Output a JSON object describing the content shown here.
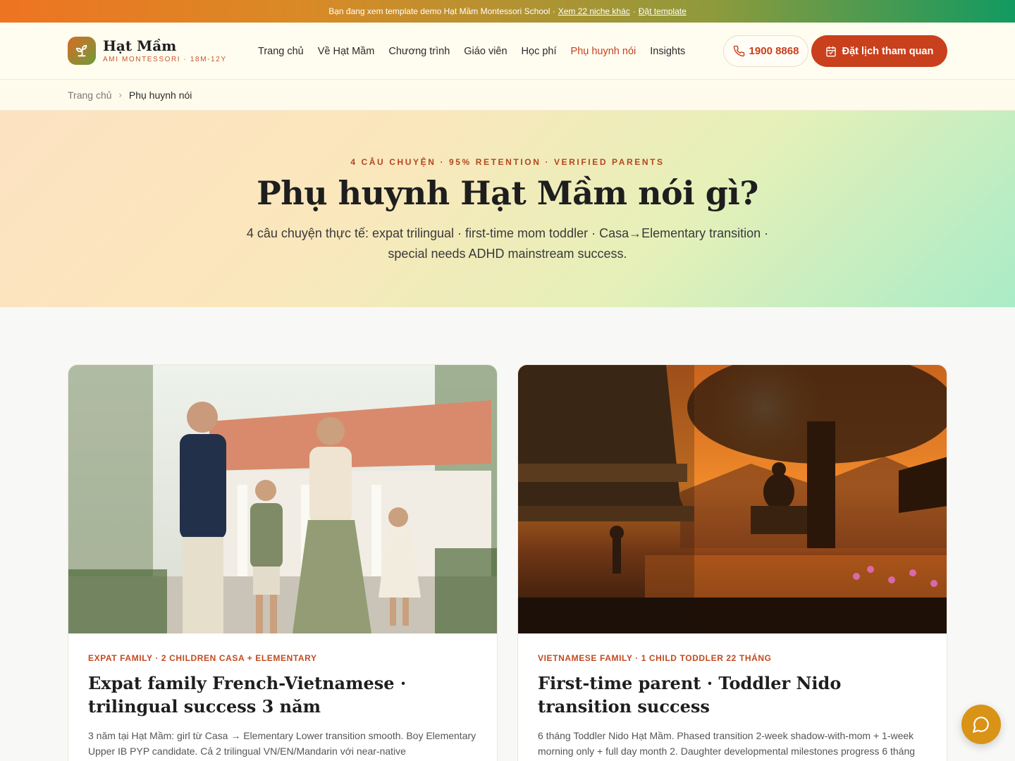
{
  "topbar": {
    "text": "Bạn đang xem template demo Hạt Mầm Montessori School ·",
    "link_more": "Xem 22 niche khác",
    "separator": "·",
    "link_order": "Đặt template"
  },
  "brand": {
    "name": "Hạt Mầm",
    "tagline": "AMI MONTESSORI · 18M-12Y",
    "logo_icon": "sprout-icon"
  },
  "nav": {
    "items": [
      "Trang chủ",
      "Về Hạt Mầm",
      "Chương trình",
      "Giáo viên",
      "Học phí",
      "Phụ huynh nói",
      "Insights"
    ],
    "active": "Phụ huynh nói"
  },
  "header": {
    "phone": "1900 8868",
    "cta": "Đặt lịch tham quan"
  },
  "breadcrumb": {
    "home": "Trang chủ",
    "current": "Phụ huynh nói"
  },
  "hero": {
    "eyebrow": "4 CÂU CHUYỆN · 95% RETENTION · VERIFIED PARENTS",
    "title": "Phụ huynh Hạt Mầm nói gì?",
    "subtitle": "4 câu chuyện thực tế: expat trilingual · first-time mom toddler · Casa→Elementary transition · special needs ADHD mainstream success."
  },
  "cards": [
    {
      "tag": "EXPAT FAMILY · 2 CHILDREN CASA + ELEMENTARY",
      "title": "Expat family French-Vietnamese · trilingual success 3 năm",
      "text": "3 năm tại Hạt Mầm: girl từ Casa → Elementary Lower transition smooth. Boy Elementary Upper IB PYP candidate. Cả 2 trilingual VN/EN/Mandarin với near-native"
    },
    {
      "tag": "VIETNAMESE FAMILY · 1 CHILD TODDLER 22 THÁNG",
      "title": "First-time parent · Toddler Nido transition success",
      "text": "6 tháng Toddler Nido Hạt Mầm. Phased transition 2-week shadow-with-mom + 1-week morning only + full day month 2. Daughter developmental milestones progress 6 tháng"
    }
  ],
  "colors": {
    "accent": "#c9401c",
    "brand_orange": "#ee7422",
    "brand_green": "#129a61",
    "fab": "#d99316"
  }
}
